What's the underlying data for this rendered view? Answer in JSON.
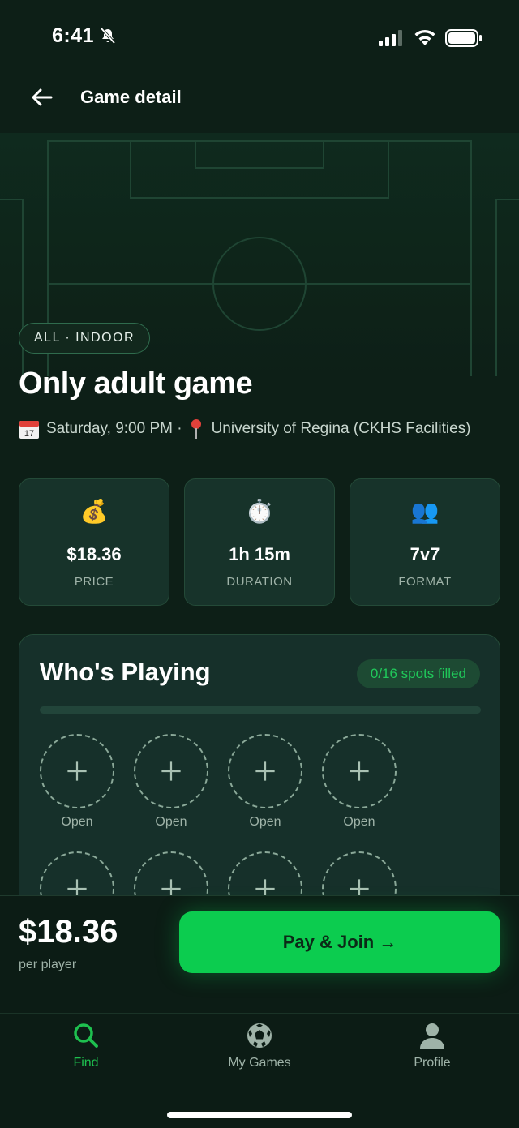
{
  "status": {
    "time": "6:41"
  },
  "header": {
    "title": "Game detail"
  },
  "game": {
    "chip": "ALL · INDOOR",
    "title": "Only adult game",
    "datetime": "Saturday, 9:00 PM ·",
    "location": "University of Regina (CKHS Facilities)"
  },
  "stats": [
    {
      "icon": "money-bag-icon",
      "emoji": "💰",
      "value": "$18.36",
      "label": "PRICE"
    },
    {
      "icon": "stopwatch-icon",
      "emoji": "⏱️",
      "value": "1h 15m",
      "label": "DURATION"
    },
    {
      "icon": "people-icon",
      "emoji": "👥",
      "value": "7v7",
      "label": "FORMAT"
    }
  ],
  "players": {
    "title": "Who's Playing",
    "spots": "0/16 spots filled",
    "filled_fraction": 0,
    "slots": [
      {
        "label": "Open"
      },
      {
        "label": "Open"
      },
      {
        "label": "Open"
      },
      {
        "label": "Open"
      },
      {
        "label": "Open"
      },
      {
        "label": "Open"
      },
      {
        "label": "Open"
      },
      {
        "label": "Open"
      }
    ]
  },
  "checkout": {
    "price": "$18.36",
    "per": "per player",
    "button": "Pay & Join →"
  },
  "tabs": [
    {
      "label": "Find",
      "icon": "search-icon",
      "active": true
    },
    {
      "label": "My Games",
      "icon": "soccer-ball-icon",
      "active": false
    },
    {
      "label": "Profile",
      "icon": "person-icon",
      "active": false
    }
  ],
  "colors": {
    "accent": "#0ccc4f",
    "background": "#0d1f17",
    "card": "#17332a"
  }
}
